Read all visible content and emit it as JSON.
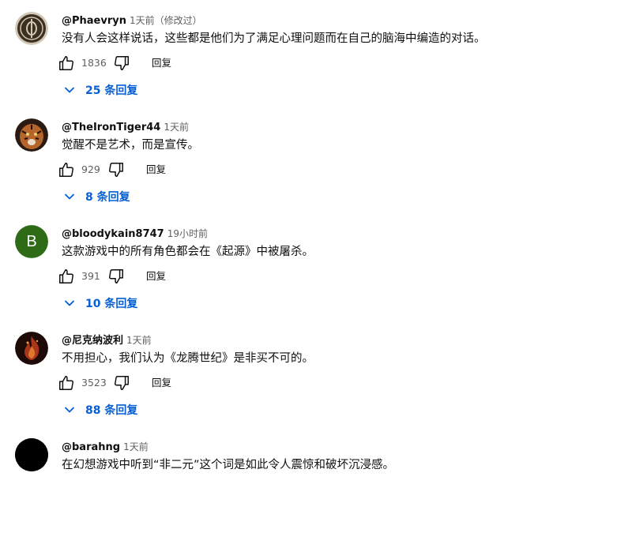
{
  "comments": [
    {
      "author": "@Phaevryn",
      "time": "1天前（修改过）",
      "text": "没有人会这样说话，这些都是他们为了满足心理问题而在自己的脑海中编造的对话。",
      "likes": "1836",
      "reply_label": "回复",
      "replies_label": "25 条回复",
      "avatar": {
        "type": "emblem",
        "color": "#3b2f20"
      }
    },
    {
      "author": "@TheIronTiger44",
      "time": "1天前",
      "text": "觉醒不是艺术，而是宣传。",
      "likes": "929",
      "reply_label": "回复",
      "replies_label": "8 条回复",
      "avatar": {
        "type": "tiger",
        "color": "#7a3b1c"
      }
    },
    {
      "author": "@bloodykain8747",
      "time": "19小时前",
      "text": "这款游戏中的所有角色都会在《起源》中被屠杀。",
      "likes": "391",
      "reply_label": "回复",
      "replies_label": "10 条回复",
      "avatar": {
        "type": "letter",
        "letter": "B",
        "color": "#2e6b17"
      }
    },
    {
      "author": "@尼克纳波利",
      "time": "1天前",
      "text": "不用担心，我们认为《龙腾世纪》是非买不可的。",
      "likes": "3523",
      "reply_label": "回复",
      "replies_label": "88 条回复",
      "avatar": {
        "type": "fire",
        "color": "#5a1a0e"
      }
    },
    {
      "author": "@barahng",
      "time": "1天前",
      "text": "在幻想游戏中听到“非二元”这个词是如此令人震惊和破坏沉浸感。",
      "avatar": {
        "type": "solid",
        "color": "#000000"
      }
    }
  ],
  "icons": {
    "like": "thumbs-up-icon",
    "dislike": "thumbs-down-icon",
    "expand": "chevron-down-icon"
  },
  "colors": {
    "link_blue": "#065fd4",
    "secondary_text": "#606060",
    "primary_text": "#0f0f0f"
  }
}
